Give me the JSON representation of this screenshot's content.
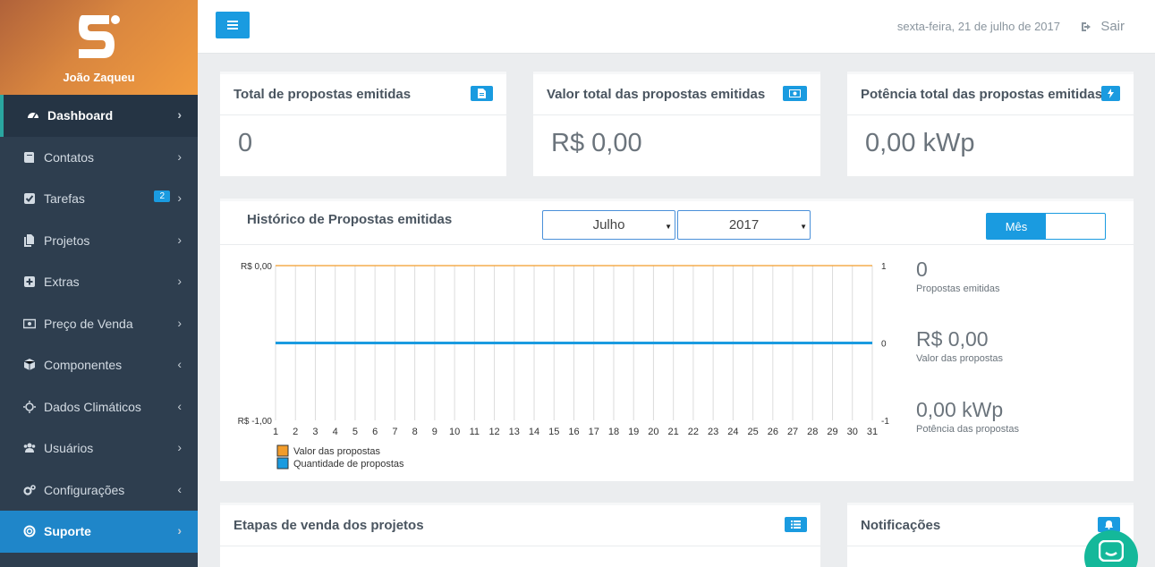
{
  "sidebar": {
    "username": "João Zaqueu",
    "items": [
      {
        "label": "Dashboard",
        "icon": "dashboard-icon",
        "arrow": "›"
      },
      {
        "label": "Contatos",
        "icon": "book-icon",
        "arrow": "›"
      },
      {
        "label": "Tarefas",
        "icon": "checkbox-icon",
        "arrow": "›",
        "badge": "2"
      },
      {
        "label": "Projetos",
        "icon": "file-icon",
        "arrow": "›"
      },
      {
        "label": "Extras",
        "icon": "plus-square-icon",
        "arrow": "›"
      },
      {
        "label": "Preço de Venda",
        "icon": "money-icon",
        "arrow": "›"
      },
      {
        "label": "Componentes",
        "icon": "cube-icon",
        "arrow": "‹"
      },
      {
        "label": "Dados Climáticos",
        "icon": "sun-icon",
        "arrow": "‹"
      },
      {
        "label": "Usuários",
        "icon": "users-icon",
        "arrow": "›"
      },
      {
        "label": "Configurações",
        "icon": "cogs-icon",
        "arrow": "‹"
      },
      {
        "label": "Suporte",
        "icon": "lifebuoy-icon",
        "arrow": "›"
      }
    ]
  },
  "topbar": {
    "date": "sexta-feira, 21 de julho de 2017",
    "logout_label": "Sair"
  },
  "cards": {
    "total_proposals": {
      "title": "Total de propostas emitidas",
      "value": "0"
    },
    "total_value": {
      "title": "Valor total das propostas emitidas",
      "value": "R$ 0,00"
    },
    "total_power": {
      "title": "Potência total das propostas emitidas",
      "value": "0,00 kWp"
    }
  },
  "history": {
    "title": "Histórico de Propostas emitidas",
    "month": "Julho",
    "year": "2017",
    "mode_label": "Mês",
    "stats": [
      {
        "value": "0",
        "label": "Propostas emitidas"
      },
      {
        "value": "R$ 0,00",
        "label": "Valor das propostas"
      },
      {
        "value": "0,00 kWp",
        "label": "Potência das propostas"
      }
    ]
  },
  "bottom": {
    "stages_title": "Etapas de venda dos projetos",
    "notifications_title": "Notificações"
  },
  "colors": {
    "accent": "#1a9be0",
    "sidebar": "#2e3e4f",
    "value_series": "#f29c2b",
    "quantity_series": "#1a9be0"
  },
  "chart_data": {
    "type": "line",
    "x": [
      1,
      2,
      3,
      4,
      5,
      6,
      7,
      8,
      9,
      10,
      11,
      12,
      13,
      14,
      15,
      16,
      17,
      18,
      19,
      20,
      21,
      22,
      23,
      24,
      25,
      26,
      27,
      28,
      29,
      30,
      31
    ],
    "left_axis_ticks": [
      "R$ 0,00",
      "R$ -1,00"
    ],
    "right_axis_ticks": [
      "1",
      "0",
      "-1"
    ],
    "ylim_left": [
      -1,
      0
    ],
    "ylim_right": [
      -1,
      1
    ],
    "grid": true,
    "legend": "bottom-left",
    "series": [
      {
        "name": "Valor das propostas",
        "axis": "left",
        "values": [
          0,
          0,
          0,
          0,
          0,
          0,
          0,
          0,
          0,
          0,
          0,
          0,
          0,
          0,
          0,
          0,
          0,
          0,
          0,
          0,
          0,
          0,
          0,
          0,
          0,
          0,
          0,
          0,
          0,
          0,
          0
        ]
      },
      {
        "name": "Quantidade de propostas",
        "axis": "right",
        "values": [
          0,
          0,
          0,
          0,
          0,
          0,
          0,
          0,
          0,
          0,
          0,
          0,
          0,
          0,
          0,
          0,
          0,
          0,
          0,
          0,
          0,
          0,
          0,
          0,
          0,
          0,
          0,
          0,
          0,
          0,
          0
        ]
      }
    ]
  }
}
